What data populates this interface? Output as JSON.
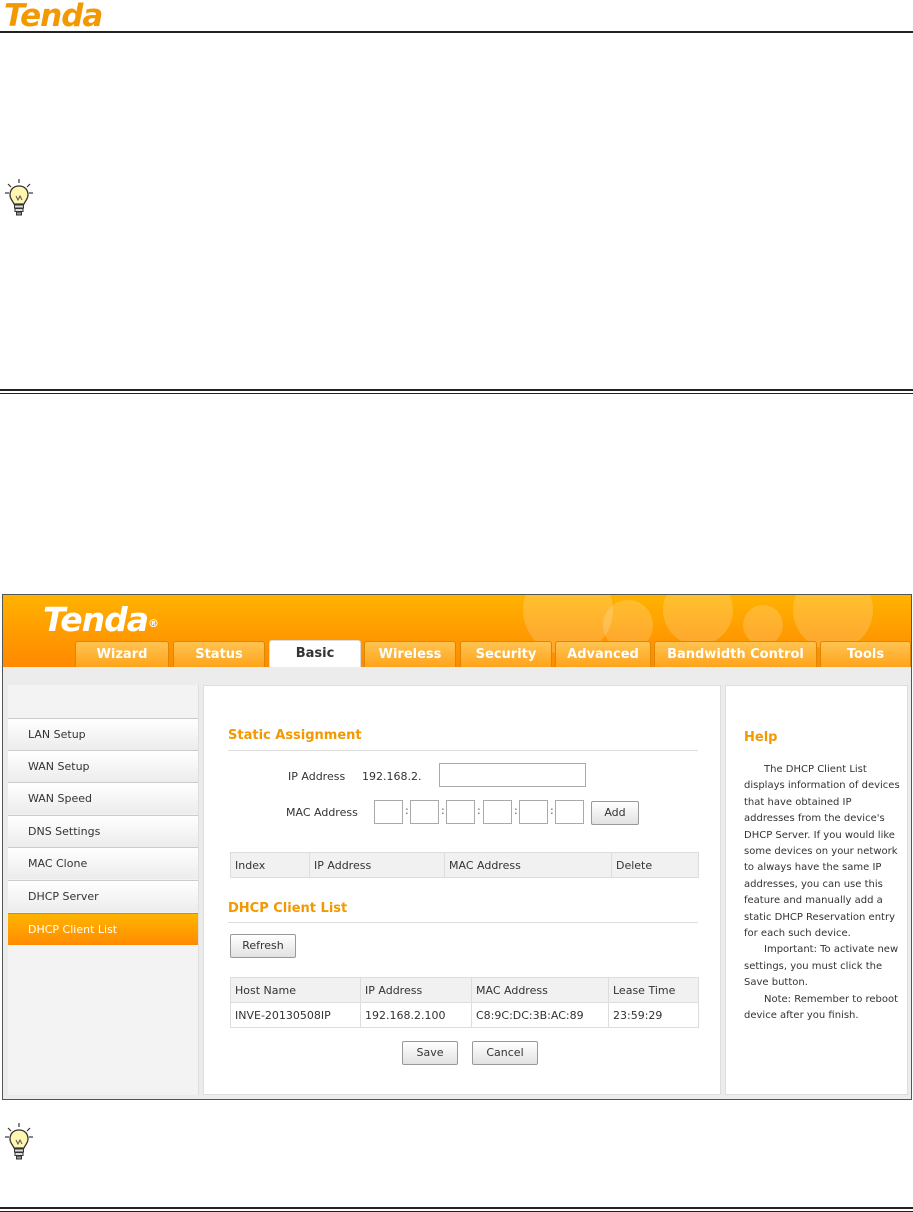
{
  "document": {
    "logo": "Tenda"
  },
  "app": {
    "logo": "Tenda",
    "logo_mark": "®",
    "tabs": [
      {
        "label": "Wizard"
      },
      {
        "label": "Status"
      },
      {
        "label": "Basic",
        "active": true
      },
      {
        "label": "Wireless"
      },
      {
        "label": "Security"
      },
      {
        "label": "Advanced"
      },
      {
        "label": "Bandwidth Control"
      },
      {
        "label": "Tools"
      }
    ],
    "accent_color": "#f39800"
  },
  "sidebar": {
    "items": [
      {
        "label": "LAN Setup"
      },
      {
        "label": "WAN Setup"
      },
      {
        "label": "WAN Speed"
      },
      {
        "label": "DNS Settings"
      },
      {
        "label": "MAC Clone"
      },
      {
        "label": "DHCP Server"
      },
      {
        "label": "DHCP Client List",
        "active": true
      }
    ]
  },
  "static_assignment": {
    "title": "Static Assignment",
    "ip_label": "IP Address",
    "ip_prefix": "192.168.2.",
    "ip_value": "",
    "mac_label": "MAC Address",
    "add_button": "Add",
    "table_headers": [
      "Index",
      "IP Address",
      "MAC Address",
      "Delete"
    ]
  },
  "client_list": {
    "title": "DHCP Client List",
    "refresh_button": "Refresh",
    "headers": [
      "Host Name",
      "IP Address",
      "MAC Address",
      "Lease Time"
    ],
    "rows": [
      [
        "INVE-20130508IP",
        "192.168.2.100",
        "C8:9C:DC:3B:AC:89",
        "23:59:29"
      ]
    ]
  },
  "actions": {
    "save": "Save",
    "cancel": "Cancel"
  },
  "help": {
    "title": "Help",
    "p1": "The DHCP Client List displays information of devices that have obtained IP addresses from the device's DHCP Server. If you would like some devices on your network to always have the same IP addresses, you can use this feature and manually add a static DHCP Reservation entry for each such device.",
    "p2": "Important: To activate new settings, you must click the Save button.",
    "p3": "Note: Remember to reboot device after you finish."
  }
}
